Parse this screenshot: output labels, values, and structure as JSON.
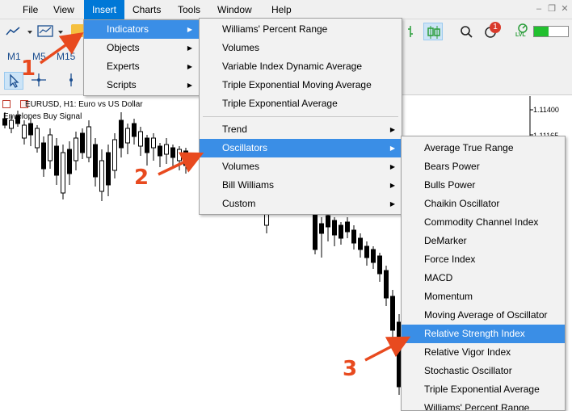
{
  "menubar": {
    "items": [
      "File",
      "View",
      "Insert",
      "Charts",
      "Tools",
      "Window",
      "Help"
    ]
  },
  "timeframes": [
    "M1",
    "M5",
    "M15"
  ],
  "notification_count": "1",
  "lvl_label": "LVL",
  "chart": {
    "title": "EURUSD, H1:  Euro vs US Dollar",
    "subtitle": "Envelopes Buy Signal",
    "prices": [
      "1.11400",
      "1.11165"
    ]
  },
  "insert_menu": [
    "Indicators",
    "Objects",
    "Experts",
    "Scripts"
  ],
  "indicators_menu": {
    "top": [
      "Williams' Percent Range",
      "Volumes",
      "Variable Index Dynamic Average",
      "Triple Exponential Moving Average",
      "Triple Exponential Average"
    ],
    "groups": [
      "Trend",
      "Oscillators",
      "Volumes",
      "Bill Williams",
      "Custom"
    ]
  },
  "oscillators_menu": [
    "Average True Range",
    "Bears Power",
    "Bulls Power",
    "Chaikin Oscillator",
    "Commodity Channel Index",
    "DeMarker",
    "Force Index",
    "MACD",
    "Momentum",
    "Moving Average of Oscillator",
    "Relative Strength Index",
    "Relative Vigor Index",
    "Stochastic Oscillator",
    "Triple Exponential Average",
    "Williams' Percent Range"
  ],
  "annotations": [
    "1",
    "2",
    "3"
  ],
  "colors": {
    "highlight": "#3a8ee6",
    "menu_active": "#0078d7",
    "annotation": "#e84a1f"
  }
}
